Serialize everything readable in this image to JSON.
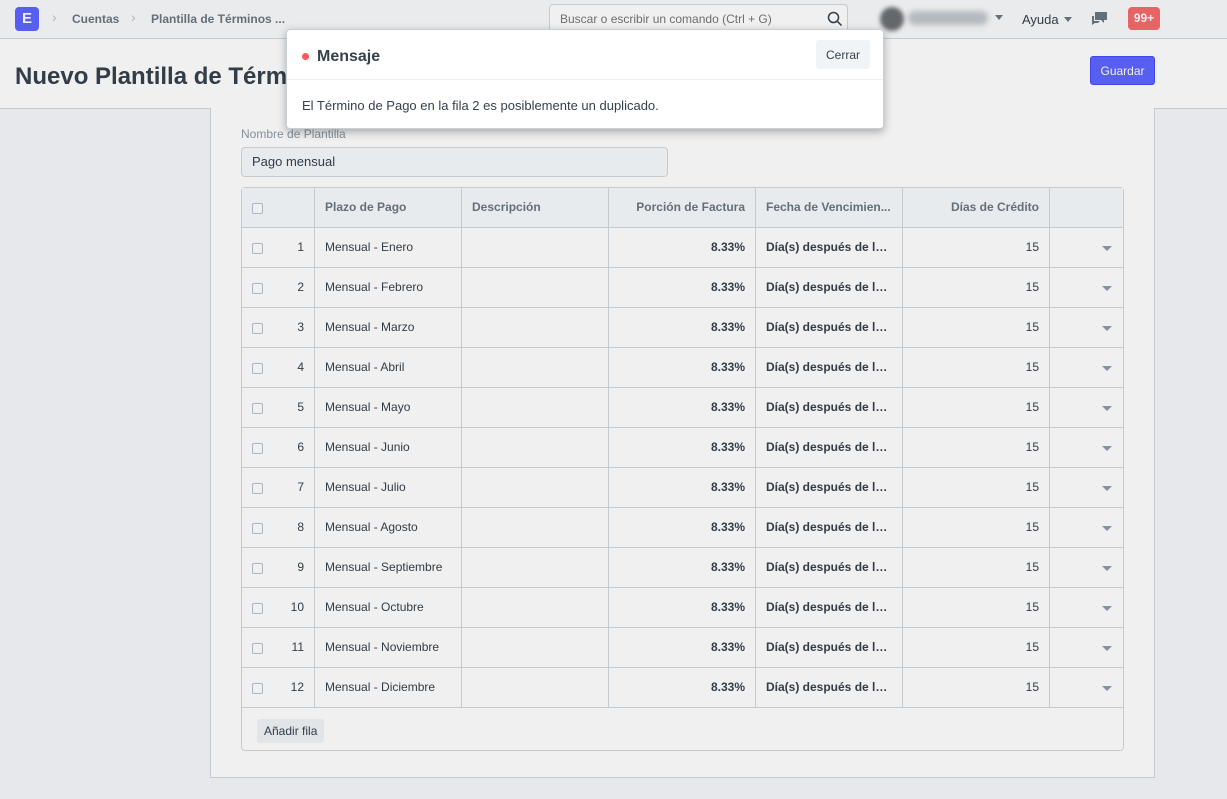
{
  "navbar": {
    "logo_letter": "E",
    "breadcrumbs": [
      "Cuentas",
      "Plantilla de Términos ..."
    ],
    "search_placeholder": "Buscar o escribir un comando (Ctrl + G)",
    "help_label": "Ayuda",
    "notification_count": "99+"
  },
  "page": {
    "title": "Nuevo Plantilla de Término",
    "save_label": "Guardar"
  },
  "form": {
    "template_name_label": "Nombre de Plantilla",
    "template_name_value": "Pago mensual",
    "add_row_label": "Añadir fila"
  },
  "grid": {
    "columns": [
      "Plazo de Pago",
      "Descripción",
      "Porción de Factura",
      "Fecha de Vencimien...",
      "Días de Crédito"
    ],
    "rows": [
      {
        "idx": "1",
        "term": "Mensual - Enero",
        "description": "",
        "portion": "8.33%",
        "due": "Día(s) después de la...",
        "days": "15"
      },
      {
        "idx": "2",
        "term": "Mensual - Febrero",
        "description": "",
        "portion": "8.33%",
        "due": "Día(s) después de la...",
        "days": "15"
      },
      {
        "idx": "3",
        "term": "Mensual - Marzo",
        "description": "",
        "portion": "8.33%",
        "due": "Día(s) después de la...",
        "days": "15"
      },
      {
        "idx": "4",
        "term": "Mensual - Abril",
        "description": "",
        "portion": "8.33%",
        "due": "Día(s) después de la...",
        "days": "15"
      },
      {
        "idx": "5",
        "term": "Mensual - Mayo",
        "description": "",
        "portion": "8.33%",
        "due": "Día(s) después de la...",
        "days": "15"
      },
      {
        "idx": "6",
        "term": "Mensual - Junio",
        "description": "",
        "portion": "8.33%",
        "due": "Día(s) después de la...",
        "days": "15"
      },
      {
        "idx": "7",
        "term": "Mensual - Julio",
        "description": "",
        "portion": "8.33%",
        "due": "Día(s) después de la...",
        "days": "15"
      },
      {
        "idx": "8",
        "term": "Mensual - Agosto",
        "description": "",
        "portion": "8.33%",
        "due": "Día(s) después de la...",
        "days": "15"
      },
      {
        "idx": "9",
        "term": "Mensual - Septiembre",
        "description": "",
        "portion": "8.33%",
        "due": "Día(s) después de la...",
        "days": "15"
      },
      {
        "idx": "10",
        "term": "Mensual - Octubre",
        "description": "",
        "portion": "8.33%",
        "due": "Día(s) después de la...",
        "days": "15"
      },
      {
        "idx": "11",
        "term": "Mensual - Noviembre",
        "description": "",
        "portion": "8.33%",
        "due": "Día(s) después de la...",
        "days": "15"
      },
      {
        "idx": "12",
        "term": "Mensual - Diciembre",
        "description": "",
        "portion": "8.33%",
        "due": "Día(s) después de la...",
        "days": "15"
      }
    ]
  },
  "modal": {
    "title": "Mensaje",
    "close_label": "Cerrar",
    "message": "El Término de Pago en la fila 2 es posiblemente un duplicado."
  },
  "colors": {
    "primary": "#5e64ff",
    "indicator_red": "#ff5858",
    "notification_red": "#f56b6b"
  },
  "icons": [
    "search-icon",
    "chat-icon",
    "chevron-right-icon",
    "caret-down-icon",
    "checkbox-icon"
  ]
}
